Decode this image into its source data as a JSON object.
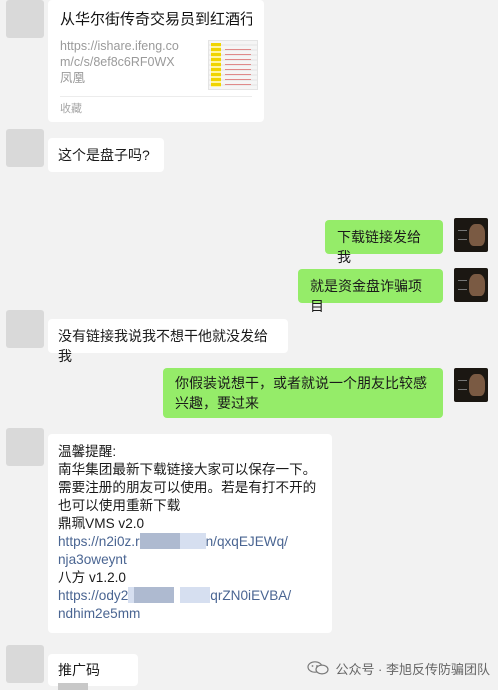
{
  "link_card": {
    "title": "从华尔街传奇交易员到红酒行...",
    "url": "https://ishare.ifeng.com/c/s/8ef8c6RF0WX",
    "source": "凤凰",
    "footer": "收藏"
  },
  "messages": [
    {
      "side": "left",
      "text": "这个是盘子吗?"
    },
    {
      "side": "right",
      "text": "下载链接发给我"
    },
    {
      "side": "right",
      "text": "就是资金盘诈骗项目"
    },
    {
      "side": "left",
      "text": "没有链接我说我不想干他就没发给我"
    },
    {
      "side": "right",
      "text": "你假装说想干，或者就说一个朋友比较感兴趣，要过来"
    }
  ],
  "notice": {
    "heading": "温馨提醒:",
    "line1": "南华集团最新下载链接大家可以保存一下。",
    "line2": "需要注册的朋友可以使用。若是有打不开的",
    "line3": "也可以使用重新下载",
    "app1_name": "鼎珮VMS v2.0",
    "app1_link_start": "https://n2i0z.r",
    "app1_link_end": "n/qxqEJEWq/",
    "app1_link_line2": "nja3oweynt",
    "app2_name": "八方 v1.2.0",
    "app2_link_start": "https://ody2",
    "app2_link_end": "qrZN0iEVBA/",
    "app2_link_line2": "ndhim2e5mm"
  },
  "promo": {
    "label": "推广码"
  },
  "watermark": {
    "text": "公众号 · 李旭反传防骗团队"
  },
  "colors": {
    "chat_bg": "#f2f2f2",
    "sent_bubble": "#95ec69",
    "received_bubble": "#ffffff",
    "link": "#4a6592"
  }
}
